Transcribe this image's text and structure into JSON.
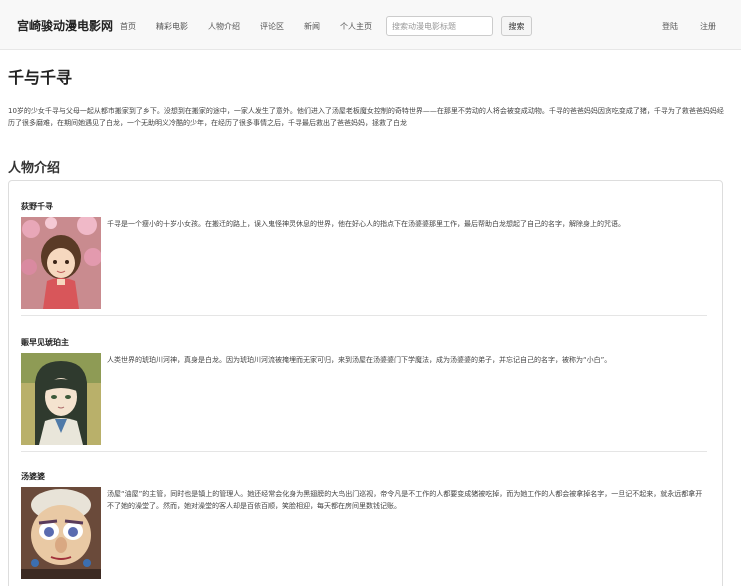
{
  "nav": {
    "brand": "宫崎骏动漫电影网",
    "links": [
      "首页",
      "精彩电影",
      "人物介绍",
      "评论区",
      "新闻",
      "个人主页"
    ],
    "search_placeholder": "搜索动漫电影标题",
    "search_button": "搜索",
    "login": "登陆",
    "register": "注册"
  },
  "main": {
    "title": "千与千寻",
    "synopsis": "10岁的少女千寻与父母一起从都市搬家到了乡下。没想到在搬家的途中，一家人发生了意外。他们进入了汤屋老板魔女控制的奇特世界——在那里不劳动的人将会被变成动物。千寻的爸爸妈妈因贪吃变成了猪，千寻为了救爸爸妈妈经历了很多磨难，在期间她遇见了白龙，一个无助明义冷酷的少年，在经历了很多事情之后，千寻最后救出了爸爸妈妈，拯救了白龙",
    "section_title": "人物介绍",
    "characters": [
      {
        "name": "荻野千寻",
        "description": "千寻是一个瘦小的十岁小女孩。在搬迁的路上，误入鬼怪神灵休息的世界，他在好心人的指点下在汤婆婆那里工作，最后帮助白龙想起了自己的名字，解除身上的咒语。"
      },
      {
        "name": "赈早见琥珀主",
        "description": "人类世界的琥珀川河神，真身是白龙。因为琥珀川河流被掩埋而无家可归，来到汤屋在汤婆婆门下学魔法，成为汤婆婆的弟子，并忘记自己的名字，被称为“小白”。"
      },
      {
        "name": "汤婆婆",
        "description": "汤屋“油屋”的主管，同时也是镇上的管理人。她还经常会化身为黑翅膀的大鸟出门巡视，帝令凡是不工作的人都要变成猪被吃掉，而为她工作的人都会被拿掉名字，一旦记不起来，就永远都拿开不了她的澡堂了。然而，她对澡堂的客人却是百依百顺，笑脸相迎，每天都在房间里数钱记账。"
      }
    ]
  }
}
